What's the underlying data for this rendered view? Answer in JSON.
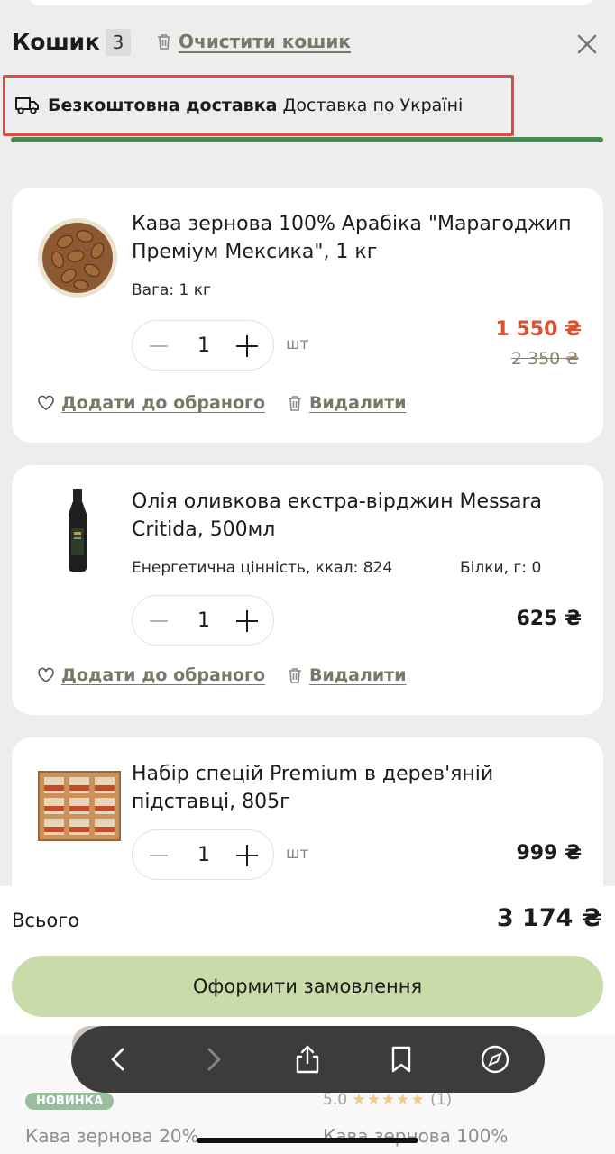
{
  "header": {
    "title": "Кошик",
    "count": "3",
    "clear_label": "Очистити кошик"
  },
  "delivery": {
    "bold": "Безкоштовна доставка",
    "text": "Доставка по Україні",
    "progress_percent": 100
  },
  "cart": {
    "items": [
      {
        "name": "Кава зернова 100% Арабіка \"Марагоджип Преміум Мексика\", 1 кг",
        "meta": "Вага: 1 кг",
        "qty": "1",
        "unit": "шт",
        "price": "1 550 ₴",
        "old_price": "2 350 ₴",
        "fav_label": "Додати до обраного",
        "remove_label": "Видалити"
      },
      {
        "name": "Олія оливкова екстра-вірджин Messara Critida, 500мл",
        "meta": "Енергетична цінність, ккал: 824",
        "meta2": "Білки, г: 0",
        "qty": "1",
        "price": "625 ₴",
        "fav_label": "Додати до обраного",
        "remove_label": "Видалити"
      },
      {
        "name": "Набір спецій Premium в дерев'яній підставці, 805г",
        "qty": "1",
        "unit": "шт",
        "price": "999 ₴"
      }
    ]
  },
  "summary": {
    "total_label": "Всього",
    "total_value": "3 174 ₴",
    "checkout_label": "Оформити замовлення"
  },
  "behind": {
    "badge": "НОВИНКА",
    "rating": "5.0",
    "stars": "★★★★★",
    "reviews": "(1)",
    "name1": "Кава зернова 20%",
    "name2": "Кава зернова 100%"
  },
  "colors": {
    "sale": "#e0502c",
    "accent_green": "#4b8a56",
    "checkout_bg": "#c9dba9",
    "link": "#727a68",
    "highlight": "#e04a46"
  }
}
